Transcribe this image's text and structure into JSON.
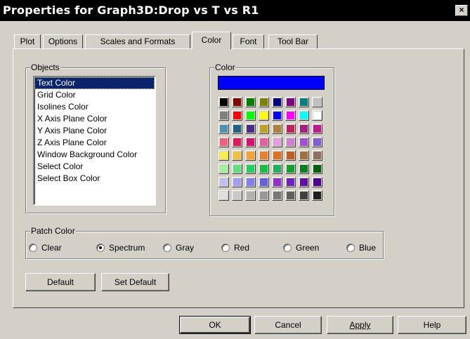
{
  "window": {
    "title": "Properties for Graph3D:Drop vs T vs R1",
    "close_label": "×"
  },
  "tabs": [
    {
      "label": "Plot"
    },
    {
      "label": "Options"
    },
    {
      "label": "Scales and Formats"
    },
    {
      "label": "Color",
      "active": true
    },
    {
      "label": "Font"
    },
    {
      "label": "Tool Bar"
    }
  ],
  "objects": {
    "group_label": "Objects",
    "items": [
      "Text Color",
      "Grid Color",
      "Isolines Color",
      "X Axis Plane Color",
      "Y Axis Plane Color",
      "Z Axis Plane Color",
      "Window Background Color",
      "Select Color",
      "Select Box Color"
    ],
    "selected_index": 0
  },
  "color": {
    "group_label": "Color",
    "current": "#0000ff",
    "palette": [
      [
        "#000000",
        "#800000",
        "#008000",
        "#808000",
        "#000080",
        "#800080",
        "#008080",
        "#c0c0c0"
      ],
      [
        "#808080",
        "#ff0000",
        "#00ff00",
        "#ffff00",
        "#0000ff",
        "#ff00ff",
        "#00ffff",
        "#ffffff"
      ],
      [
        "#4b93b0",
        "#206080",
        "#4b2d88",
        "#c0a020",
        "#b08040",
        "#c02060",
        "#a02080",
        "#c01890"
      ],
      [
        "#f06080",
        "#e01860",
        "#d81070",
        "#e060a0",
        "#e0a0e0",
        "#d080d0",
        "#a050d0",
        "#8060d0"
      ],
      [
        "#f8f040",
        "#f0c040",
        "#f8a030",
        "#e88030",
        "#e07020",
        "#c06020",
        "#a07040",
        "#907060"
      ],
      [
        "#a0f0a0",
        "#60e080",
        "#20d060",
        "#10c040",
        "#20b060",
        "#10a030",
        "#008020",
        "#006010"
      ],
      [
        "#c0c0f0",
        "#a0a0f0",
        "#8080f0",
        "#6060e0",
        "#9030d0",
        "#7020c0",
        "#6010a0",
        "#500090"
      ],
      [
        "#e0e0e0",
        "#c8c8c8",
        "#b0b0b0",
        "#989898",
        "#787878",
        "#606060",
        "#404040",
        "#202020"
      ]
    ]
  },
  "patch": {
    "group_label": "Patch Color",
    "options": [
      "Clear",
      "Spectrum",
      "Gray",
      "Red",
      "Green",
      "Blue"
    ],
    "selected": "Spectrum"
  },
  "buttons": {
    "default": "Default",
    "set_default": "Set Default",
    "ok": "OK",
    "cancel": "Cancel",
    "apply": "Apply",
    "help": "Help"
  }
}
